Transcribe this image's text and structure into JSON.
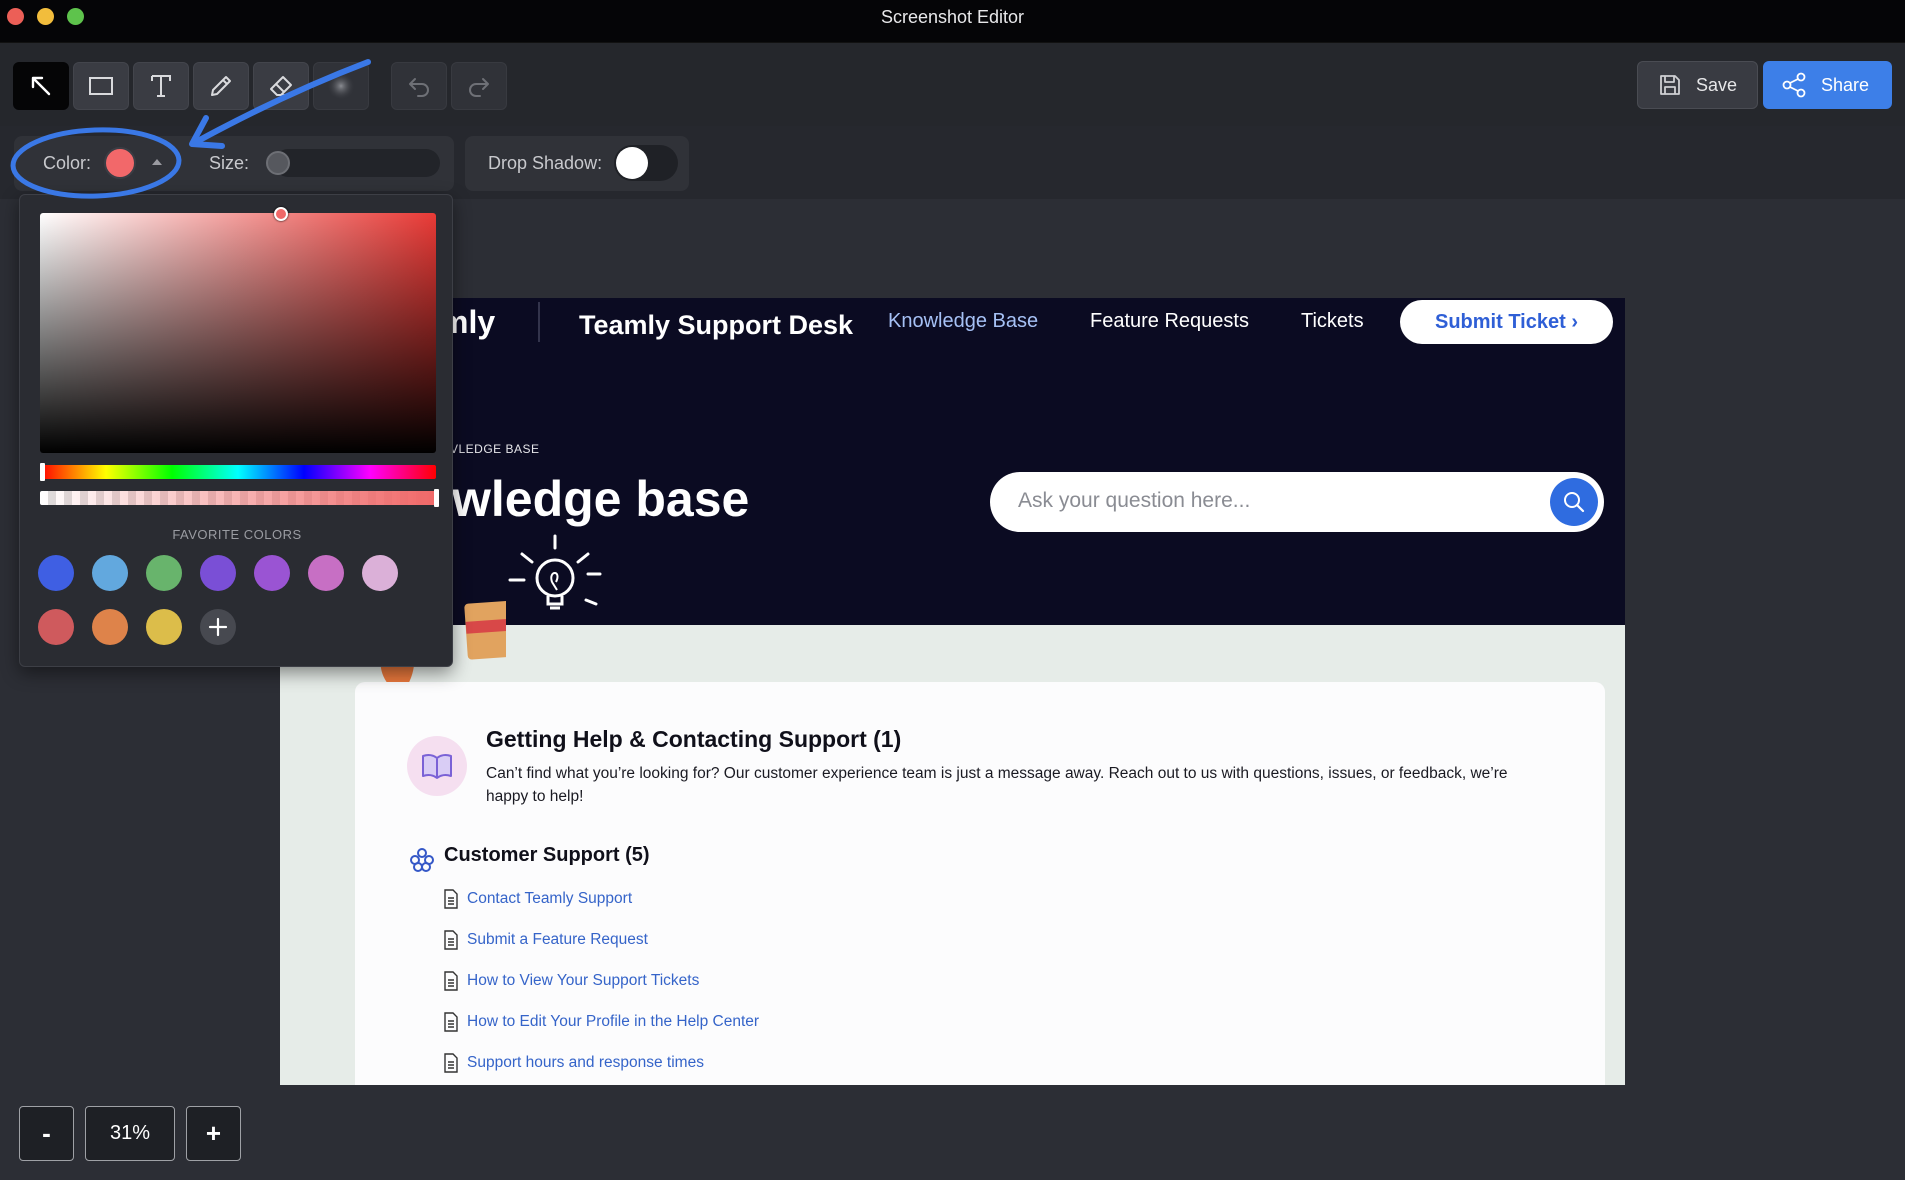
{
  "window": {
    "title": "Screenshot Editor"
  },
  "toolbar": {
    "tools": [
      {
        "name": "select-tool",
        "icon": "arrow-pointer-icon",
        "active": true
      },
      {
        "name": "rectangle-tool",
        "icon": "rectangle-icon"
      },
      {
        "name": "text-tool",
        "icon": "text-icon"
      },
      {
        "name": "pen-tool",
        "icon": "pencil-icon"
      },
      {
        "name": "eraser-tool",
        "icon": "eraser-icon"
      },
      {
        "name": "blur-tool",
        "icon": "blur-icon"
      }
    ],
    "undo_icon": "undo-icon",
    "redo_icon": "redo-icon",
    "save_label": "Save",
    "share_label": "Share"
  },
  "options": {
    "color_label": "Color:",
    "color_value": "#f2686a",
    "size_label": "Size:",
    "size_value": 0,
    "drop_shadow_label": "Drop Shadow:",
    "drop_shadow_on": false
  },
  "color_picker": {
    "favorite_label": "FAVORITE COLORS",
    "favorites": [
      "#3f5fe3",
      "#62a8de",
      "#68b46c",
      "#7a4fd6",
      "#9a54d3",
      "#c76fc4",
      "#dbb0d8",
      "#cf5a5d",
      "#de834a",
      "#dcbd4a"
    ],
    "add_icon": "plus-icon"
  },
  "screenshot": {
    "logo_fragment": "mly",
    "desk_title": "Teamly Support Desk",
    "nav": [
      "Knowledge Base",
      "Feature Requests",
      "Tickets"
    ],
    "submit_ticket": "Submit Ticket ›",
    "eyebrow": "VLEDGE BASE",
    "hero_title": "wledge base",
    "search_placeholder": "Ask your question here...",
    "section_title": "Getting Help & Contacting Support (1)",
    "section_desc": "Can’t find what you’re looking for? Our customer experience team is just a message away. Reach out to us with questions, issues, or feedback, we’re happy to help!",
    "category_title": "Customer Support (5)",
    "articles": [
      "Contact Teamly Support",
      "Submit a Feature Request",
      "How to View Your Support Tickets",
      "How to Edit Your Profile in the Help Center",
      "Support hours and response times"
    ]
  },
  "zoom": {
    "minus": "-",
    "value": "31%",
    "plus": "+"
  }
}
